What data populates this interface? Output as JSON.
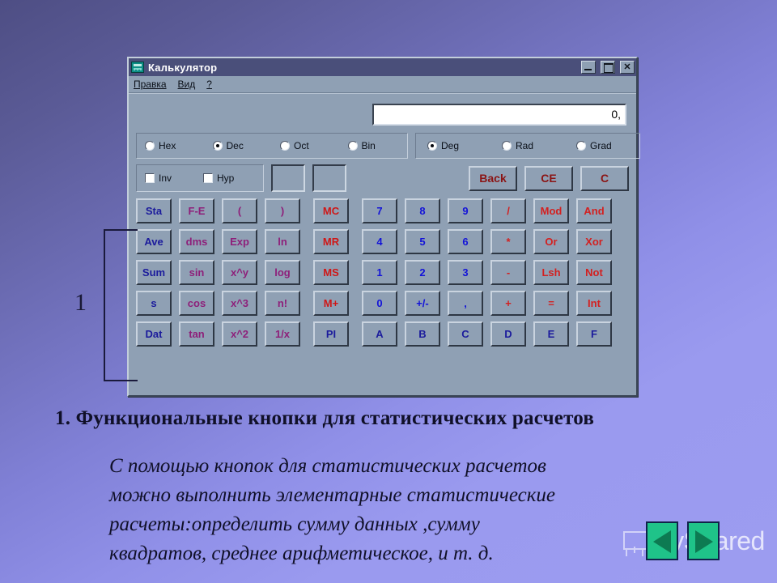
{
  "window": {
    "title": "Калькулятор",
    "app_icon": "calculator-icon",
    "controls": {
      "minimize": "_",
      "maximize": "□",
      "close": "✕"
    },
    "menu": [
      {
        "label": "Правка"
      },
      {
        "label": "Вид"
      },
      {
        "label": "?"
      }
    ],
    "display": {
      "value": "0,"
    },
    "number_base": {
      "options": [
        "Hex",
        "Dec",
        "Oct",
        "Bin"
      ],
      "selected": "Dec"
    },
    "angle_unit": {
      "options": [
        "Deg",
        "Rad",
        "Grad"
      ],
      "selected": "Deg"
    },
    "modifiers": [
      {
        "label": "Inv",
        "checked": false
      },
      {
        "label": "Hyp",
        "checked": false
      }
    ],
    "indicators": [
      "",
      ""
    ],
    "edit_buttons": [
      {
        "label": "Back",
        "color": "#8b1414"
      },
      {
        "label": "CE",
        "color": "#8b1414"
      },
      {
        "label": "C",
        "color": "#8b1414"
      }
    ],
    "keypad_rows": [
      {
        "stat": "Sta",
        "functions": [
          "F-E",
          "(",
          ")"
        ],
        "memory": "MC",
        "main": [
          "7",
          "8",
          "9",
          "/",
          "Mod",
          "And"
        ]
      },
      {
        "stat": "Ave",
        "functions": [
          "dms",
          "Exp",
          "ln"
        ],
        "memory": "MR",
        "main": [
          "4",
          "5",
          "6",
          "*",
          "Or",
          "Xor"
        ]
      },
      {
        "stat": "Sum",
        "functions": [
          "sin",
          "x^y",
          "log"
        ],
        "memory": "MS",
        "main": [
          "1",
          "2",
          "3",
          "-",
          "Lsh",
          "Not"
        ]
      },
      {
        "stat": "s",
        "functions": [
          "cos",
          "x^3",
          "n!"
        ],
        "memory": "M+",
        "main": [
          "0",
          "+/-",
          ",",
          "+",
          "=",
          "Int"
        ]
      },
      {
        "stat": "Dat",
        "functions": [
          "tan",
          "x^2",
          "1/x"
        ],
        "memory": "PI",
        "main": [
          "A",
          "B",
          "C",
          "D",
          "E",
          "F"
        ]
      }
    ],
    "colors": {
      "face": "#8fa0b4",
      "titlebar": "#4a4f7a",
      "stat_text": "#1b1b9c",
      "function_text": "#8e1f7a",
      "memory_text": "#cf1717",
      "number_text": "#1313d8",
      "operator_text": "#d32020",
      "edit_text": "#8b1414"
    }
  },
  "annotation": {
    "label": "1",
    "target": "stat-button-column"
  },
  "slide": {
    "heading": "1. Функциональные  кнопки  для  статистических  расчетов",
    "body_lines": [
      "С помощью кнопок для статистических расчетов",
      "можно выполнить элементарные статистические",
      "расчеты:определить сумму данных ,сумму",
      "квадратов, среднее арифметическое, и т. д."
    ]
  },
  "watermark": {
    "text": "MyShared",
    "logo_icon": "presentation-board-icon"
  },
  "navigation": {
    "prev_icon": "triangle-left-icon",
    "next_icon": "triangle-right-icon"
  }
}
